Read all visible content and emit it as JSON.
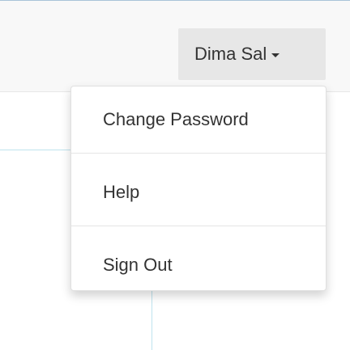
{
  "navbar": {
    "user_menu": {
      "label": "Dima Sal",
      "caret_icon": "caret-down-icon"
    }
  },
  "dropdown": {
    "items": [
      {
        "label": "Change Password"
      },
      {
        "label": "Help"
      },
      {
        "label": "Sign Out"
      }
    ]
  },
  "colors": {
    "navbar_bg": "#f8f8f8",
    "toggle_bg": "#e7e7e7",
    "text": "#333333",
    "divider": "#e5e5e5",
    "background_lines": "#bfe3ee"
  }
}
